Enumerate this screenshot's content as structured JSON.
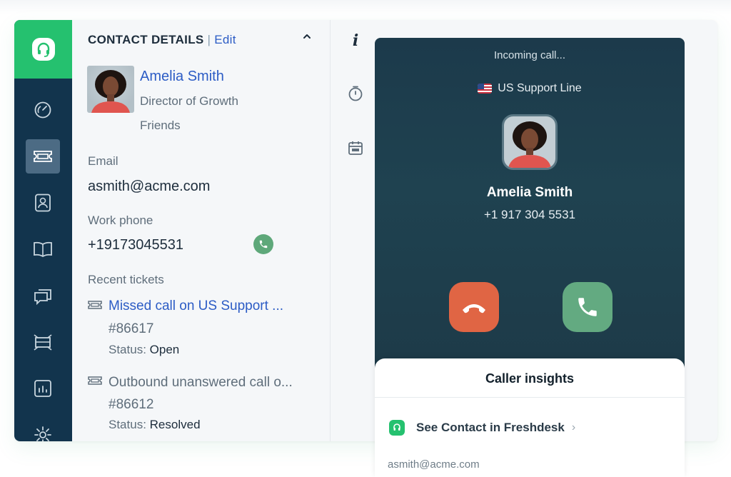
{
  "colors": {
    "sidebar": "#12344d",
    "brand_green": "#25c16f",
    "link_blue": "#2c5cc5",
    "call_background": "#1f4250",
    "decline_red": "#e06544",
    "accept_green": "#63aa81"
  },
  "sidebar": {
    "logo_icon": "freshdesk-headset-icon",
    "items": [
      {
        "icon": "dashboard-icon",
        "active": false
      },
      {
        "icon": "tickets-icon",
        "active": true
      },
      {
        "icon": "contacts-icon",
        "active": false
      },
      {
        "icon": "solutions-book-icon",
        "active": false
      },
      {
        "icon": "discussions-icon",
        "active": false
      },
      {
        "icon": "admin-icon",
        "active": false
      },
      {
        "icon": "reports-icon",
        "active": false
      },
      {
        "icon": "settings-gear-icon",
        "active": false
      }
    ]
  },
  "contact_details": {
    "heading": "CONTACT DETAILS",
    "separator": "|",
    "edit_label": "Edit",
    "name": "Amelia Smith",
    "title": "Director of Growth",
    "company": "Friends",
    "email_label": "Email",
    "email": "asmith@acme.com",
    "work_phone_label": "Work phone",
    "work_phone": "+19173045531",
    "recent_tickets_label": "Recent tickets",
    "tickets": [
      {
        "title": "Missed call on US Support ...",
        "id": "#86617",
        "status_label": "Status:",
        "status": "Open"
      },
      {
        "title": "Outbound unanswered call o...",
        "id": "#86612",
        "status_label": "Status:",
        "status": "Resolved"
      }
    ]
  },
  "mini_toolbar": {
    "info_glyph": "i",
    "icons": [
      "info-icon",
      "timer-icon",
      "calendar-icon"
    ]
  },
  "call": {
    "status": "Incoming call...",
    "line_name": "US Support Line",
    "caller_name": "Amelia Smith",
    "caller_number": "+1 917 304 5531"
  },
  "insights": {
    "title": "Caller insights",
    "see_contact_label": "See Contact in Freshdesk",
    "chevron": "›",
    "email": "asmith@acme.com"
  }
}
